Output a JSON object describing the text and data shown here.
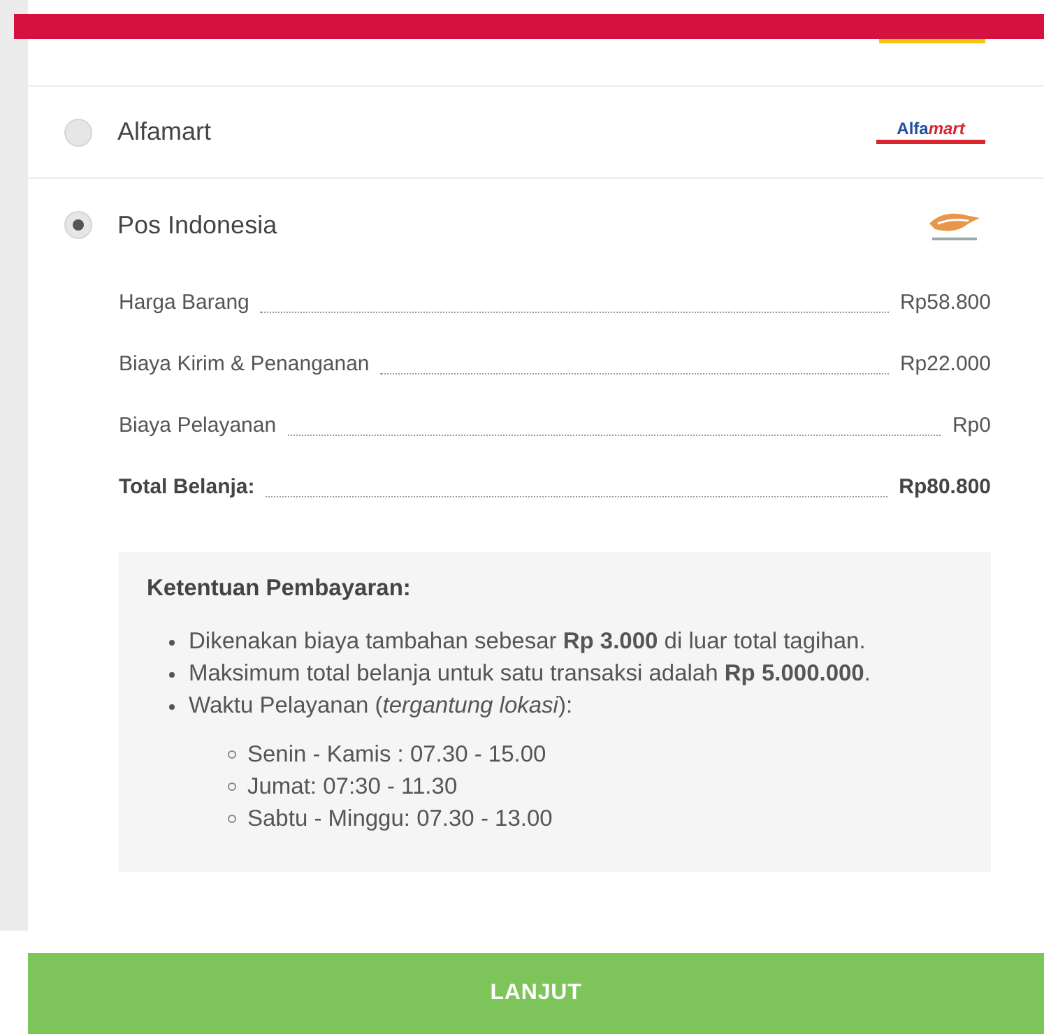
{
  "payment_options": [
    {
      "label": "Alfamart",
      "selected": false,
      "kind": "text-logo",
      "logo_text": "Alfa",
      "logo_text_accent": "mart"
    },
    {
      "label": "Pos Indonesia",
      "selected": true,
      "kind": "bird-logo"
    }
  ],
  "summary": [
    {
      "label": "Harga Barang",
      "value": "Rp58.800",
      "emphasis": false
    },
    {
      "label": "Biaya Kirim & Penanganan",
      "value": "Rp22.000",
      "emphasis": false
    },
    {
      "label": "Biaya Pelayanan",
      "value": "Rp0",
      "emphasis": false
    },
    {
      "label": "Total Belanja:",
      "value": "Rp80.800",
      "emphasis": true
    }
  ],
  "terms": {
    "title": "Ketentuan Pembayaran:",
    "items": [
      {
        "text": "Dikenakan biaya tambahan sebesar **Rp 3.000** di luar total tagihan."
      },
      {
        "text": "Maksimum total belanja untuk satu transaksi adalah **Rp 5.000.000**."
      },
      {
        "text": "Waktu Pelayanan (*tergantung lokasi*):",
        "children": [
          {
            "text": "Senin - Kamis : 07.30 - 15.00"
          },
          {
            "text": "Jumat: 07:30 - 11.30"
          },
          {
            "text": "Sabtu - Minggu: 07.30 - 13.00"
          }
        ]
      }
    ]
  },
  "button": {
    "label": "LANJUT"
  }
}
